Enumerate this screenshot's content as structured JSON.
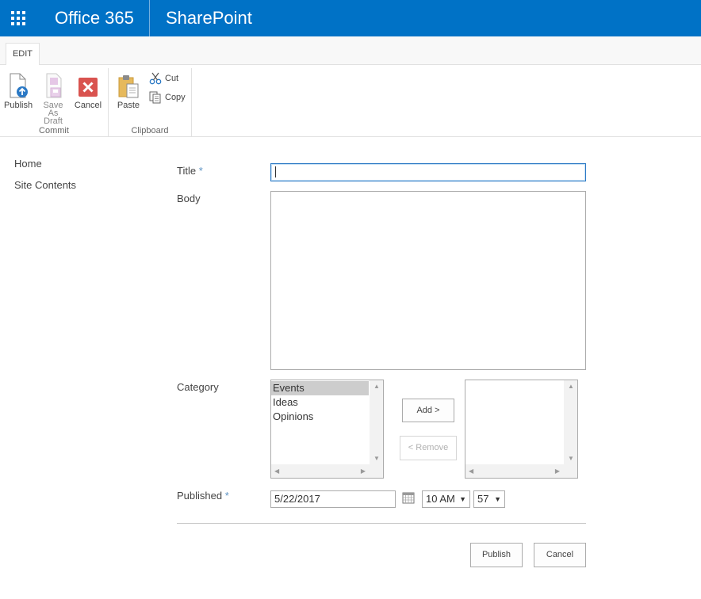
{
  "suitebar": {
    "brand": "Office 365",
    "app_title": "SharePoint"
  },
  "ribbon": {
    "tab_label": "EDIT",
    "commit": {
      "label": "Commit",
      "publish": "Publish",
      "save_as_draft_line1": "Save As",
      "save_as_draft_line2": "Draft",
      "cancel": "Cancel"
    },
    "clipboard": {
      "label": "Clipboard",
      "paste": "Paste",
      "cut": "Cut",
      "copy": "Copy"
    }
  },
  "leftnav": {
    "items": [
      {
        "label": "Home"
      },
      {
        "label": "Site Contents"
      }
    ]
  },
  "form": {
    "title_label": "Title",
    "required_marker": "*",
    "title_value": "",
    "body_label": "Body",
    "body_value": "",
    "category_label": "Category",
    "category_options": [
      "Events",
      "Ideas",
      "Opinions"
    ],
    "category_selected": "Events",
    "add_button": "Add >",
    "remove_button": "< Remove",
    "published_label": "Published",
    "published_date": "5/22/2017",
    "published_hour": "10 AM",
    "published_minute": "57",
    "publish_button": "Publish",
    "cancel_button": "Cancel"
  },
  "colors": {
    "suitebar": "#0072c6",
    "required": "#5d93c4",
    "focus_border": "#2b79c5",
    "cancel_icon": "#d9534f"
  }
}
